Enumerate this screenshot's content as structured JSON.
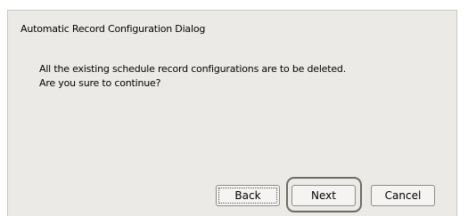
{
  "dialog": {
    "title": "Automatic Record Configuration Dialog",
    "message_line1": "All the existing schedule record configurations are to be deleted.",
    "message_line2": "Are you sure to continue?"
  },
  "buttons": {
    "back_label": "Back",
    "next_label": "Next",
    "cancel_label": "Cancel"
  },
  "colors": {
    "dialog_background": "#eceae7",
    "page_background": "#ffffff"
  }
}
